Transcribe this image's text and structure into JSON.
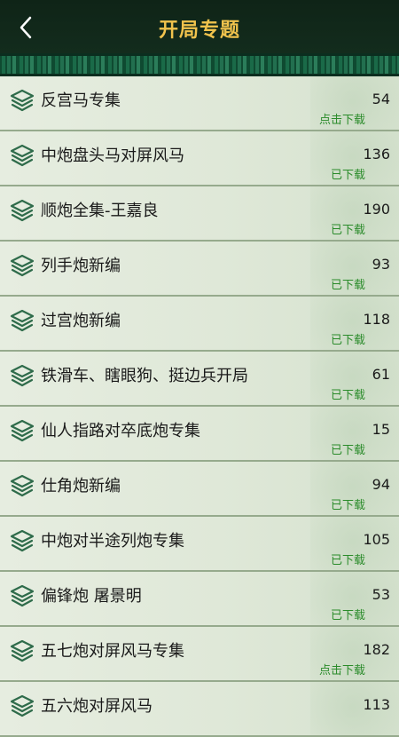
{
  "header": {
    "title": "开局专题",
    "back_icon": "chevron-left-icon"
  },
  "list": {
    "items": [
      {
        "name": "反宫马专集",
        "count": "54",
        "status": "点击下载"
      },
      {
        "name": "中炮盘头马对屏风马",
        "count": "136",
        "status": "已下载"
      },
      {
        "name": "顺炮全集-王嘉良",
        "count": "190",
        "status": "已下载"
      },
      {
        "name": "列手炮新编",
        "count": "93",
        "status": "已下载"
      },
      {
        "name": "过宫炮新编",
        "count": "118",
        "status": "已下载"
      },
      {
        "name": "铁滑车、瞎眼狗、挺边兵开局",
        "count": "61",
        "status": "已下载"
      },
      {
        "name": "仙人指路对卒底炮专集",
        "count": "15",
        "status": "已下载"
      },
      {
        "name": "仕角炮新编",
        "count": "94",
        "status": "已下载"
      },
      {
        "name": "中炮对半途列炮专集",
        "count": "105",
        "status": "已下载"
      },
      {
        "name": "偏锋炮 屠景明",
        "count": "53",
        "status": "已下载"
      },
      {
        "name": "五七炮对屏风马专集",
        "count": "182",
        "status": "点击下载"
      },
      {
        "name": "五六炮对屏风马",
        "count": "113",
        "status": ""
      }
    ]
  },
  "colors": {
    "header_bg": "#132c1d",
    "title": "#f1c34d",
    "status_green": "#2a8b2a"
  }
}
